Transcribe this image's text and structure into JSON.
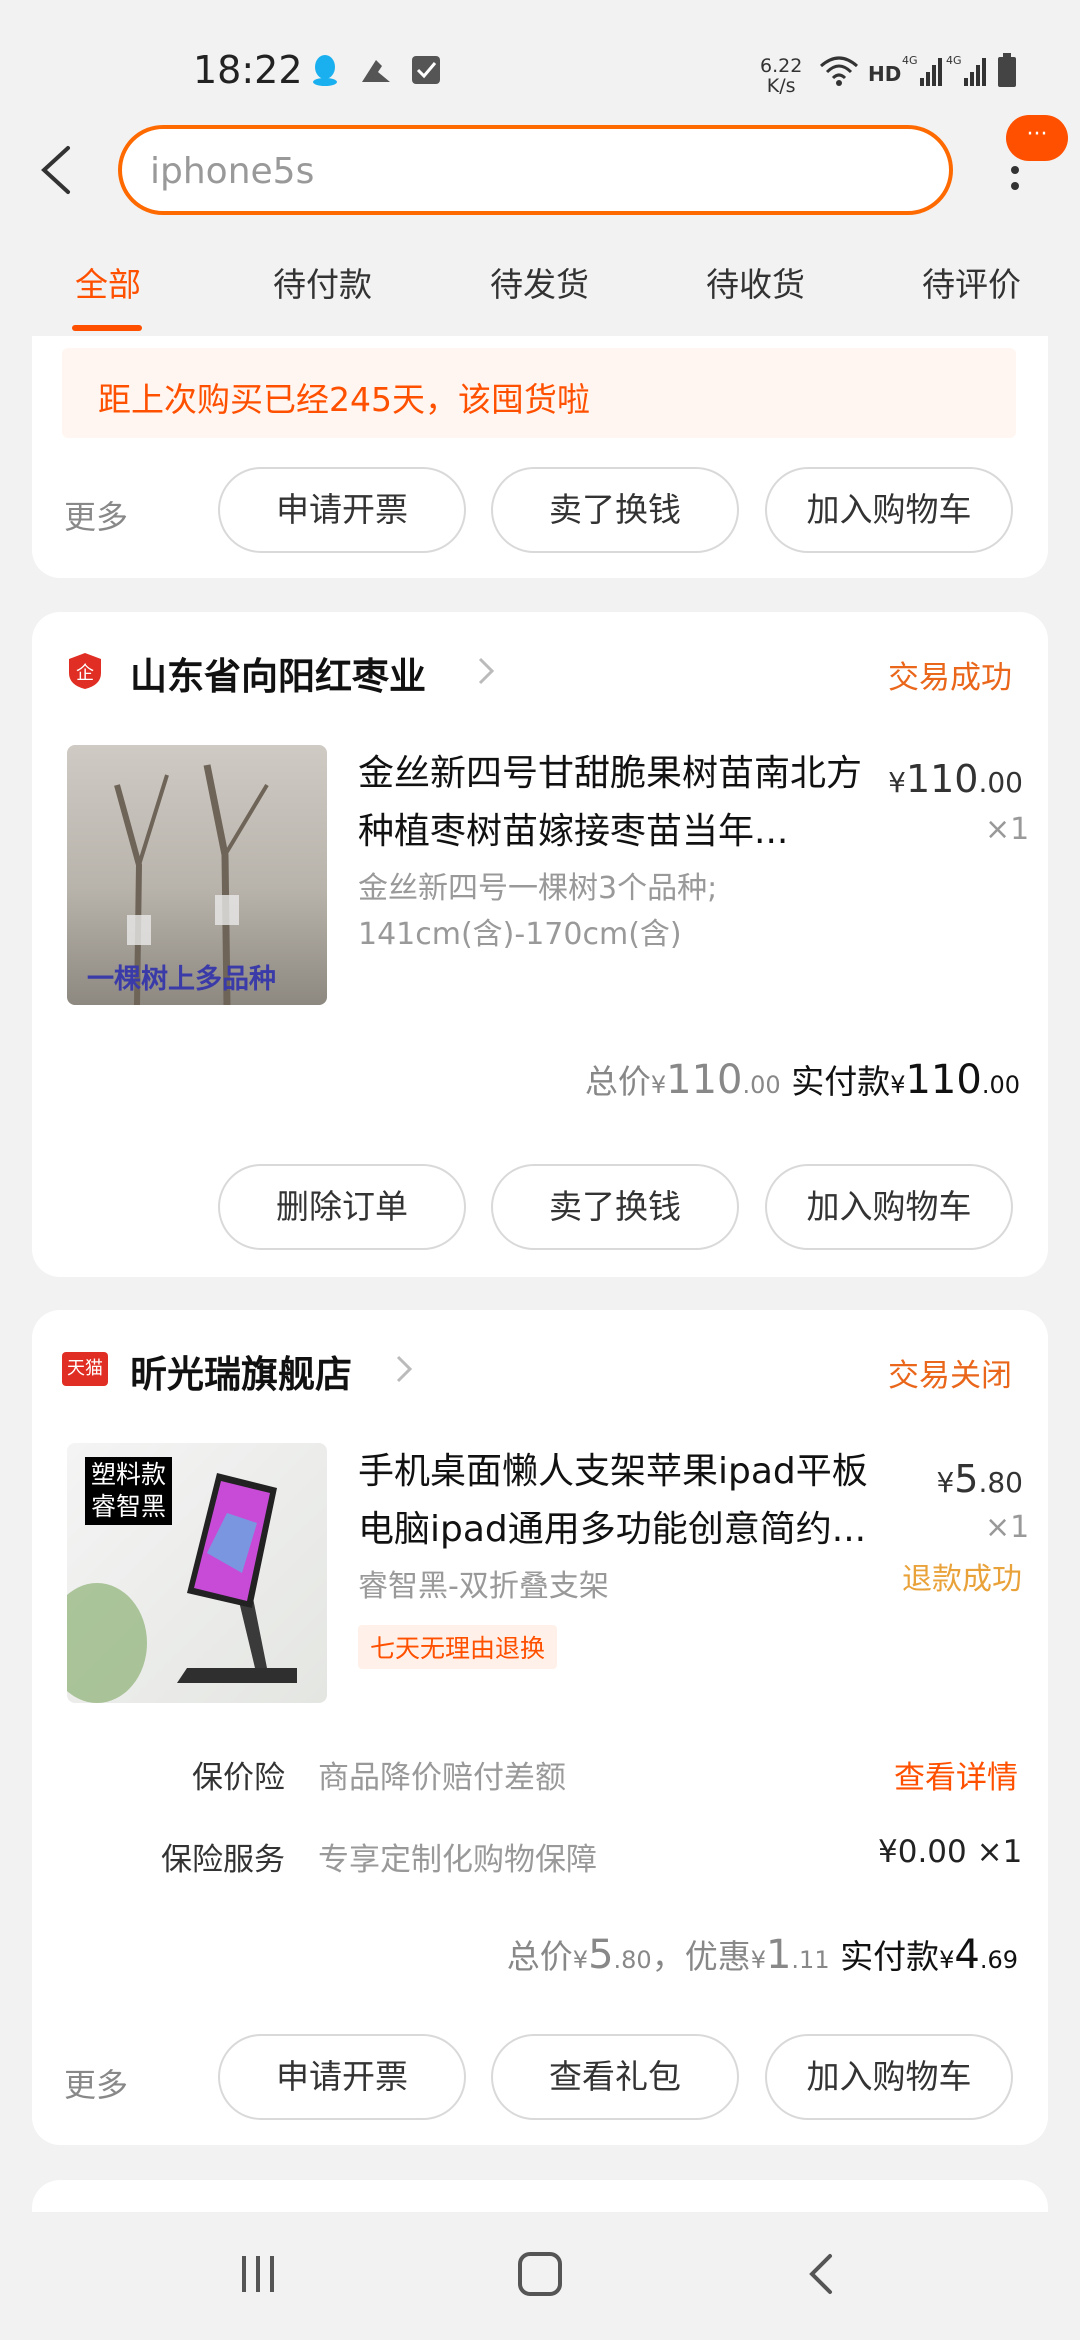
{
  "status_bar": {
    "time": "18:22",
    "net_speed_value": "6.22",
    "net_speed_unit": "K/s",
    "hd": "HD",
    "icons": [
      "qq-icon",
      "fitness-icon",
      "checkbox-icon",
      "wifi-icon",
      "signal-4g-icon",
      "signal-4g-icon",
      "battery-icon"
    ]
  },
  "header": {
    "search_value": "iphone5s",
    "bubble": "···"
  },
  "tabs": [
    {
      "label": "全部",
      "active": true
    },
    {
      "label": "待付款",
      "active": false
    },
    {
      "label": "待发货",
      "active": false
    },
    {
      "label": "待收货",
      "active": false
    },
    {
      "label": "待评价",
      "active": false
    }
  ],
  "card0": {
    "notice": "距上次购买已经245天，该囤货啦",
    "more": "更多",
    "buttons": [
      "申请开票",
      "卖了换钱",
      "加入购物车"
    ]
  },
  "card1": {
    "shop_name": "山东省向阳红枣业",
    "status": "交易成功",
    "thumb_caption": "一棵树上多品种",
    "title": "金丝新四号甘甜脆果树苗南北方种植枣树苗嫁接枣苗当年...",
    "sku_line1": "金丝新四号一棵树3个品种;",
    "sku_line2": "141cm(含)-170cm(含)",
    "price_currency": "¥",
    "price_int": "110",
    "price_dec": ".00",
    "qty": "×1",
    "total_label": "总价",
    "total_currency": "¥",
    "total_int": "110",
    "total_dec": ".00",
    "paid_label": "实付款",
    "paid_currency": "¥",
    "paid_int": "110",
    "paid_dec": ".00",
    "buttons": [
      "删除订单",
      "卖了换钱",
      "加入购物车"
    ]
  },
  "card2": {
    "shop_badge": "天猫",
    "shop_name": "昕光瑞旗舰店",
    "status": "交易关闭",
    "thumb_caption1": "塑料款",
    "thumb_caption2": "睿智黑",
    "title": "手机桌面懒人支架苹果ipad平板电脑ipad通用多功能创意简约...",
    "sku": "睿智黑-双折叠支架",
    "tag": "七天无理由退换",
    "price_currency": "¥",
    "price_int": "5",
    "price_dec": ".80",
    "qty": "×1",
    "refund": "退款成功",
    "insurance": [
      {
        "label": "保价险",
        "desc": "商品降价赔付差额",
        "right": "查看详情"
      },
      {
        "label": "保险服务",
        "desc": "专享定制化购物保障",
        "right": "¥0.00 ×1"
      }
    ],
    "total_label": "总价",
    "total_currency": "¥",
    "total_int": "5",
    "total_dec": ".80",
    "discount_label": "，优惠",
    "discount_currency": "¥",
    "discount_int": "1",
    "discount_dec": ".11",
    "paid_label": "实付款",
    "paid_currency": "¥",
    "paid_int": "4",
    "paid_dec": ".69",
    "more": "更多",
    "buttons": [
      "申请开票",
      "查看礼包",
      "加入购物车"
    ]
  },
  "colors": {
    "accent": "#ff5000",
    "search_border": "#ff6a00",
    "status_orange": "#e9661a",
    "refund_gold": "#e9a23a",
    "background": "#f2f2f2"
  }
}
